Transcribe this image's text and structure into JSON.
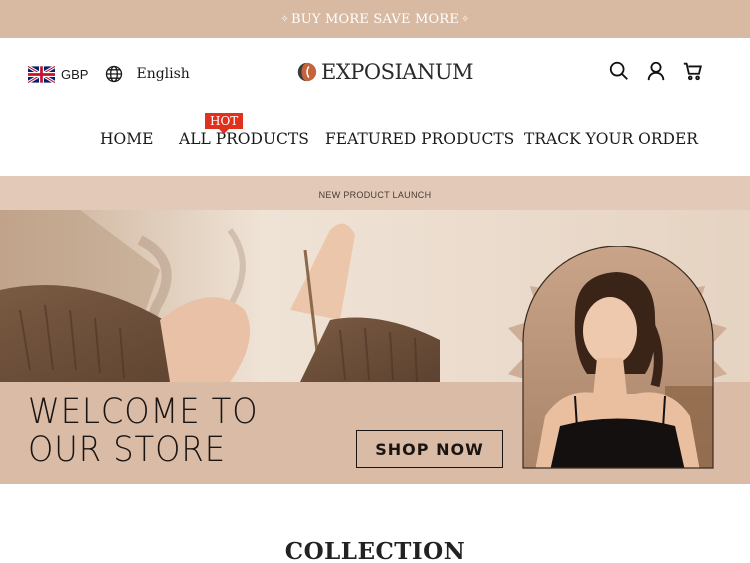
{
  "announcement": {
    "text": "BUY MORE SAVE MORE"
  },
  "header": {
    "currency": "GBP",
    "language": "English",
    "logo_text": "EXPOSIANUM"
  },
  "nav": {
    "items": [
      {
        "label": "HOME"
      },
      {
        "label": "ALL PRODUCTS",
        "badge": "HOT"
      },
      {
        "label": "FEATURED PRODUCTS"
      },
      {
        "label": "TRACK YOUR ORDER"
      }
    ]
  },
  "hero": {
    "tag": "NEW PRODUCT LAUNCH",
    "title_line1": "WELCOME TO",
    "title_line2": "OUR STORE",
    "cta_label": "SHOP NOW"
  },
  "section": {
    "title": "COLLECTION"
  },
  "icons": [
    "uk-flag-icon",
    "globe-icon",
    "search-icon",
    "account-icon",
    "cart-icon"
  ],
  "colors": {
    "announce_bg": "#d8b9a2",
    "hot_badge": "#e1301c",
    "hero_bg": "#d9bba6"
  }
}
